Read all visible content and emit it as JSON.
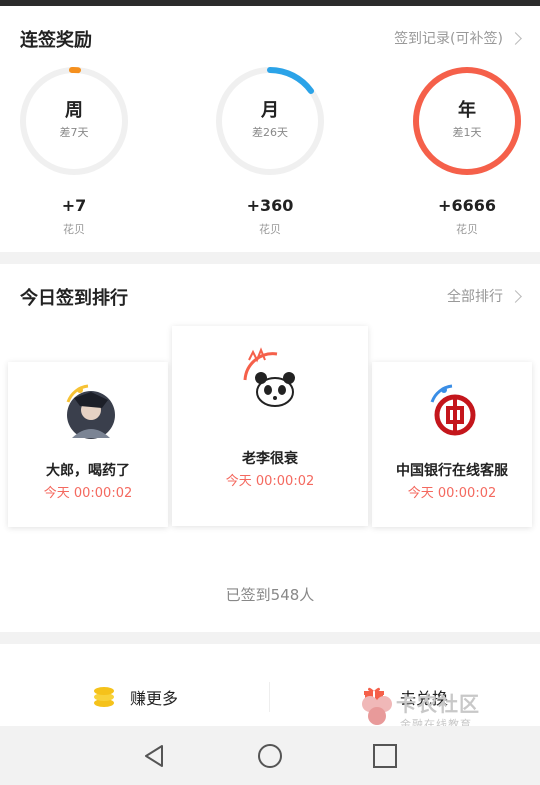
{
  "streak": {
    "title": "连签奖励",
    "record_link": "签到记录(可补签)",
    "rings": [
      {
        "label": "周",
        "sub": "差7天",
        "progress": 0.01,
        "reward": "+7",
        "unit": "花贝"
      },
      {
        "label": "月",
        "sub": "差26天",
        "progress": 0.16,
        "reward": "+360",
        "unit": "花贝"
      },
      {
        "label": "年",
        "sub": "差1天",
        "progress": 1.0,
        "reward": "+6666",
        "unit": "花贝"
      }
    ]
  },
  "ranking": {
    "title": "今日签到排行",
    "all_link": "全部排行",
    "entries": [
      {
        "name": "老李很衰",
        "time": "今天 00:00:02"
      },
      {
        "name": "大郎，喝药了",
        "time": "今天 00:00:02"
      },
      {
        "name": "中国银行在线客服",
        "time": "今天 00:00:02"
      }
    ],
    "count_text": "已签到548人"
  },
  "bottom_bar": {
    "earn_label": "赚更多",
    "exchange_label": "去兑换"
  },
  "watermark": {
    "title": "卡农社区",
    "subtitle": "金融在线教育"
  },
  "colors": {
    "ring_track": "#f0f0f0",
    "week_progress": "#f5901e",
    "month_progress": "#2ba3e8",
    "year_progress": "#f5604a",
    "time_red": "#f4695f"
  }
}
